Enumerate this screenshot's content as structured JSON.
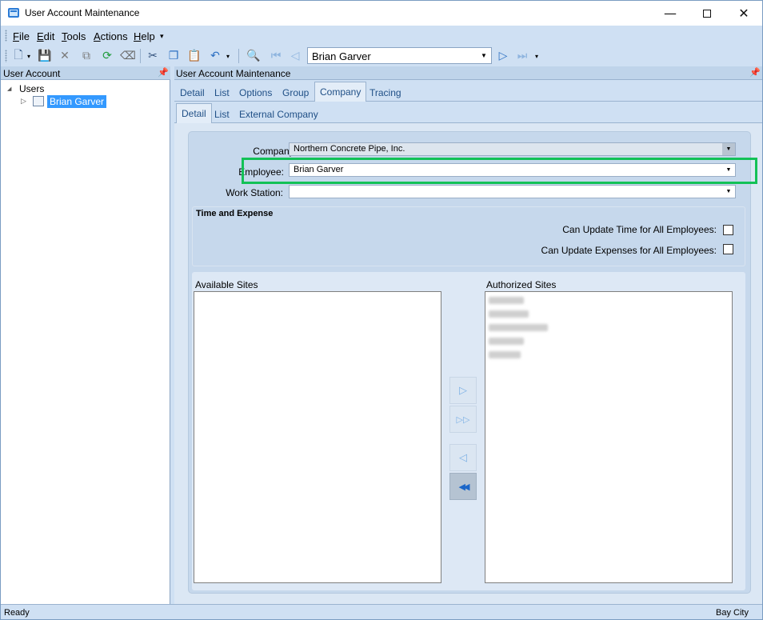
{
  "window": {
    "title": "User Account Maintenance",
    "min_glyph": "—",
    "close_glyph": "✕"
  },
  "menu": {
    "items": [
      {
        "accel": "F",
        "rest": "ile"
      },
      {
        "accel": "E",
        "rest": "dit"
      },
      {
        "accel": "T",
        "rest": "ools"
      },
      {
        "accel": "A",
        "rest": "ctions"
      },
      {
        "accel": "H",
        "rest": "elp"
      }
    ],
    "more_glyph": "▾"
  },
  "toolbar": {
    "navigator_value": "Brian Garver",
    "icons": {
      "new": "🗋",
      "dropdown": "▾",
      "save": "💾",
      "delete": "✕",
      "copy": "⧉",
      "refresh": "⟳",
      "clear": "⌫",
      "cut": "✂",
      "copy2": "❐",
      "paste": "📋",
      "undo": "↶",
      "find": "🔍",
      "first": "⏮",
      "prev": "◁",
      "next": "▷",
      "last": "⏭"
    }
  },
  "left_panel": {
    "title": "User Account",
    "pin_glyph": "📌",
    "tree": {
      "root_label": "Users",
      "root_expander": "◢",
      "child_expander": "▷",
      "child_label": "Brian Garver"
    }
  },
  "right_panel": {
    "title": "User Account Maintenance",
    "pin_glyph": "📌",
    "tabs_primary": [
      "Detail",
      "List",
      "Options",
      "Group",
      "Company",
      "Tracing"
    ],
    "tabs_primary_active": "Company",
    "tabs_secondary": [
      "Detail",
      "List",
      "External Company"
    ],
    "tabs_secondary_active": "Detail"
  },
  "form": {
    "company_label": "Company:",
    "company_value": "Northern Concrete Pipe, Inc.",
    "employee_label": "Employee:",
    "employee_value": "Brian Garver",
    "workstation_label": "Work Station:",
    "workstation_value": "",
    "combo_arrow": "▼",
    "time_expense": {
      "title": "Time and Expense",
      "update_time_label": "Can Update Time for All Employees:",
      "update_time_checked": false,
      "update_expenses_label": "Can Update Expenses for All Employees:",
      "update_expenses_checked": false
    },
    "sites": {
      "available_label": "Available Sites",
      "authorized_label": "Authorized Sites",
      "move_right": "▷",
      "move_all_right": "▷▷",
      "move_left": "◁",
      "move_all_left": "◀◀"
    }
  },
  "status": {
    "left": "Ready",
    "right": "Bay City"
  }
}
